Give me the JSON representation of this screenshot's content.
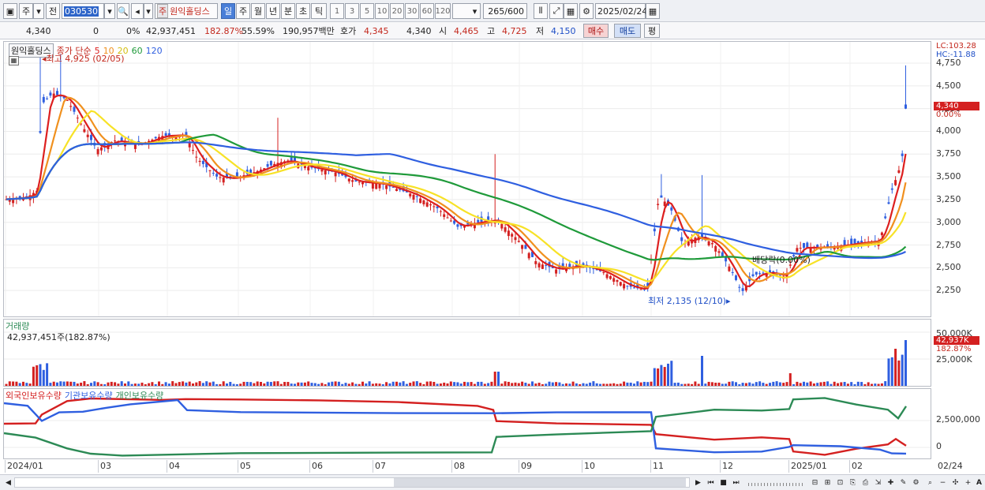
{
  "toolbar": {
    "period_label": "주",
    "prev_label": "전",
    "code": "030530",
    "stock_name": "원익홀딩스",
    "period_buttons": [
      "일",
      "주",
      "월",
      "년",
      "분",
      "초",
      "틱"
    ],
    "interval_buttons": [
      "1",
      "3",
      "5",
      "10",
      "20",
      "30",
      "60",
      "120"
    ],
    "count": "265",
    "count_total": "/600",
    "date": "2025/02/24"
  },
  "quote": {
    "price": "4,340",
    "change": "0",
    "change_pct": "0%",
    "volume": "42,937,451",
    "volume_pct": "182.87%",
    "ratio": "55.59%",
    "amount": "190,957백만",
    "bid_label": "호가",
    "bid": "4,345",
    "ask": "4,340",
    "open_label": "시",
    "open": "4,465",
    "high_label": "고",
    "high": "4,725",
    "low_label": "저",
    "low": "4,150",
    "buy_label": "매수",
    "sell_label": "매도",
    "avg_label": "평"
  },
  "price_panel": {
    "stock_label": "원익홀딩스",
    "ma_label": "종가 단순",
    "ma_periods": [
      "5",
      "10",
      "20",
      "60",
      "120"
    ],
    "ma_colors": [
      "#dd1f1f",
      "#f0901e",
      "#f7e227",
      "#1f9a3a",
      "#2f5fe0"
    ],
    "high_note": "최고 4,925 (02/05)",
    "low_note": "최저 2,135 (12/10)",
    "dividend_note": "배당락(0.00%)",
    "lc": "LC:103.28",
    "hc": "HC:-11.88",
    "price_tag": "4,340",
    "pct_tag": "0.00%",
    "y_ticks": [
      "4,750",
      "4,500",
      "4,250",
      "4,000",
      "3,750",
      "3,500",
      "3,250",
      "3,000",
      "2,750",
      "2,500",
      "2,250"
    ]
  },
  "volume_panel": {
    "title": "거래량",
    "value": "42,937,451주(182.87%)",
    "y_ticks": [
      "50,000K",
      "25,000K"
    ],
    "tag_value": "42,937K",
    "tag_pct": "182.87%"
  },
  "holding_panel": {
    "foreign": "외국인보유수량",
    "institution": "기관보유수량",
    "individual": "개인보유수량",
    "foreign_color": "#d42020",
    "institution_color": "#2f5fe0",
    "individual_color": "#2c8a55",
    "y_ticks": [
      "2,500,000",
      "0"
    ]
  },
  "xaxis": {
    "labels": [
      "2024/01",
      "03",
      "04",
      "05",
      "06",
      "07",
      "08",
      "09",
      "10",
      "11",
      "12",
      "2025/01",
      "02"
    ],
    "right_label": "02/24"
  },
  "chart_data": {
    "type": "candlestick",
    "y_range": [
      2000,
      4950
    ],
    "high": {
      "value": 4925,
      "date": "02/05"
    },
    "low": {
      "value": 2135,
      "date": "12/10"
    },
    "last": 4340,
    "month_ticks": [
      "2024/01",
      "03",
      "04",
      "05",
      "06",
      "07",
      "08",
      "09",
      "10",
      "11",
      "12",
      "2025/01",
      "02"
    ],
    "close_path": [
      [
        "2024/01",
        3250
      ],
      [
        "2024/02 early",
        4400
      ],
      [
        "2024/02 mid",
        4150
      ],
      [
        "2024/03",
        3900
      ],
      [
        "2024/04",
        4000
      ],
      [
        "2024/05",
        3500
      ],
      [
        "2024/06",
        3700
      ],
      [
        "2024/07",
        3450
      ],
      [
        "2024/08",
        3150
      ],
      [
        "2024/08 late",
        2900
      ],
      [
        "2024/09",
        2450
      ],
      [
        "2024/10",
        2250
      ],
      [
        "2024/11 early",
        3150
      ],
      [
        "2024/11",
        2750
      ],
      [
        "2024/12",
        2250
      ],
      [
        "2025/01",
        2700
      ],
      [
        "2025/02",
        2850
      ],
      [
        "02/24",
        4340
      ]
    ]
  }
}
